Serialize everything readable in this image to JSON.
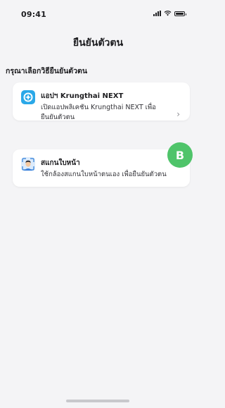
{
  "status_bar": {
    "time": "09:41"
  },
  "header": {
    "title": "ยืนยันตัวตน"
  },
  "section": {
    "label": "กรุณาเลือกวิธียืนยันตัวตน"
  },
  "options": [
    {
      "title": "แอปฯ Krungthai NEXT",
      "description": "เปิดแอปพลิเคชัน Krungthai NEXT เพื่อยืนยันตัวตน",
      "icon": "krungthai-next-app-icon"
    },
    {
      "title": "สแกนใบหน้า",
      "description": "ใช้กล้องสแกนใบหน้าตนเอง เพื่อยืนยันตัวตน",
      "icon": "face-scan-icon"
    }
  ],
  "badge": {
    "label": "B"
  },
  "colors": {
    "accent": "#4fc46a",
    "app_icon_blue": "#2aa8e8"
  }
}
